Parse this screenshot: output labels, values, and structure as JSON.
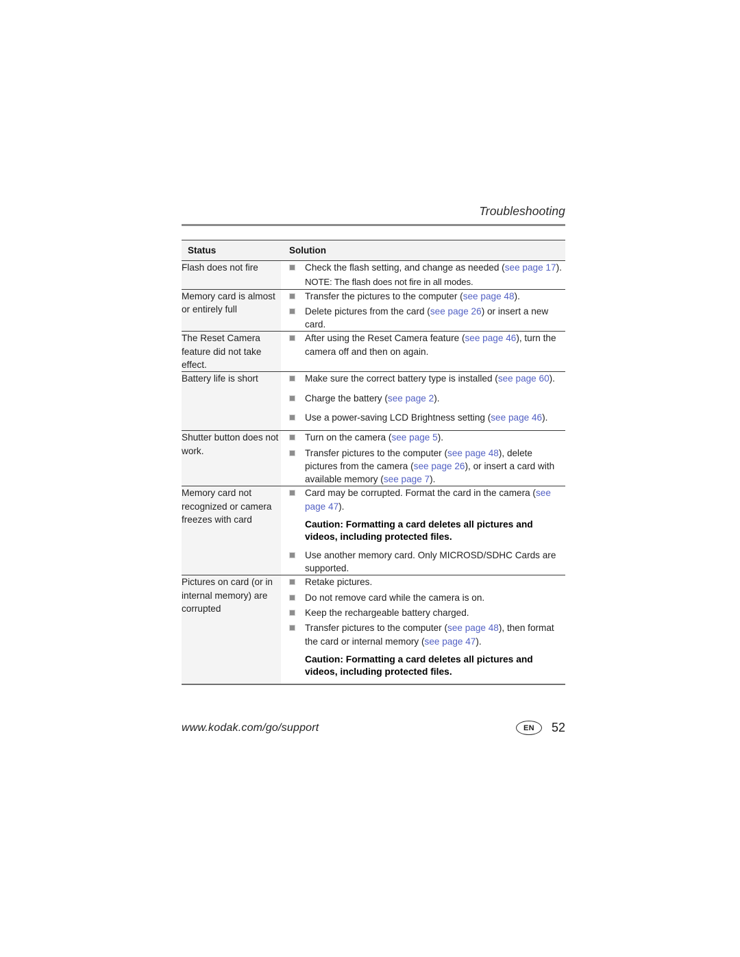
{
  "running_head": {
    "title": "Troubleshooting"
  },
  "table": {
    "headers": {
      "status": "Status",
      "solution": "Solution"
    },
    "rows": [
      {
        "status": "Flash does not fire",
        "items": [
          {
            "bullet": true,
            "parts": [
              {
                "t": "Check the flash setting, and change as needed ("
              },
              {
                "t": "see page 17",
                "link": true
              },
              {
                "t": ")."
              }
            ]
          },
          {
            "bullet": false,
            "note": true,
            "parts": [
              {
                "t": "NOTE:  The flash does not fire in all modes."
              }
            ]
          }
        ]
      },
      {
        "status": "Memory card is almost or entirely full",
        "items": [
          {
            "bullet": true,
            "parts": [
              {
                "t": "Transfer the pictures to the computer ("
              },
              {
                "t": "see page 48",
                "link": true
              },
              {
                "t": ")."
              }
            ]
          },
          {
            "bullet": true,
            "parts": [
              {
                "t": "Delete pictures from the card ("
              },
              {
                "t": "see page 26",
                "link": true
              },
              {
                "t": ") or insert a new card."
              }
            ]
          }
        ]
      },
      {
        "status": "The Reset Camera feature did not take effect.",
        "items": [
          {
            "bullet": true,
            "parts": [
              {
                "t": "After using the Reset Camera feature ("
              },
              {
                "t": "see page 46",
                "link": true
              },
              {
                "t": "), turn the camera off and then on again."
              }
            ]
          }
        ]
      },
      {
        "status": "Battery life is short",
        "items": [
          {
            "bullet": true,
            "parts": [
              {
                "t": "Make sure the correct battery type is installed ("
              },
              {
                "t": "see page 60",
                "link": true
              },
              {
                "t": ")."
              }
            ]
          },
          {
            "bullet": true,
            "parts": [
              {
                "t": "Charge the battery ("
              },
              {
                "t": "see page 2",
                "link": true
              },
              {
                "t": ")."
              }
            ]
          },
          {
            "bullet": true,
            "parts": [
              {
                "t": "Use a power-saving LCD Brightness setting ("
              },
              {
                "t": "see page 46",
                "link": true
              },
              {
                "t": ")."
              }
            ]
          }
        ]
      },
      {
        "status": "Shutter button does not work.",
        "items": [
          {
            "bullet": true,
            "parts": [
              {
                "t": "Turn on the camera ("
              },
              {
                "t": "see page 5",
                "link": true
              },
              {
                "t": ")."
              }
            ]
          },
          {
            "bullet": true,
            "parts": [
              {
                "t": "Transfer pictures to the computer ("
              },
              {
                "t": "see page 48",
                "link": true
              },
              {
                "t": "), delete pictures from the camera ("
              },
              {
                "t": "see page 26",
                "link": true
              },
              {
                "t": "), or insert a card with available memory ("
              },
              {
                "t": "see page 7",
                "link": true
              },
              {
                "t": ")."
              }
            ]
          }
        ]
      },
      {
        "status": "Memory card not recognized or camera freezes with card",
        "items": [
          {
            "bullet": true,
            "parts": [
              {
                "t": "Card may be corrupted. Format the card in the camera ("
              },
              {
                "t": "see page 47",
                "link": true
              },
              {
                "t": ")."
              }
            ]
          },
          {
            "bullet": false,
            "caution": true,
            "parts": [
              {
                "t": "Caution: Formatting a card deletes all pictures and videos, including protected files."
              }
            ]
          },
          {
            "bullet": true,
            "parts": [
              {
                "t": "Use another memory card. Only MICROSD/SDHC Cards are supported."
              }
            ]
          }
        ]
      },
      {
        "status": "Pictures on card (or in internal memory) are corrupted",
        "items": [
          {
            "bullet": true,
            "parts": [
              {
                "t": "Retake pictures."
              }
            ]
          },
          {
            "bullet": true,
            "parts": [
              {
                "t": "Do not remove card while the camera is on."
              }
            ]
          },
          {
            "bullet": true,
            "parts": [
              {
                "t": "Keep the rechargeable battery charged."
              }
            ]
          },
          {
            "bullet": true,
            "parts": [
              {
                "t": "Transfer pictures to the computer ("
              },
              {
                "t": "see page 48",
                "link": true
              },
              {
                "t": "), then format the card or internal memory ("
              },
              {
                "t": "see page 47",
                "link": true
              },
              {
                "t": ")."
              }
            ]
          },
          {
            "bullet": false,
            "caution": true,
            "parts": [
              {
                "t": "Caution: Formatting a card deletes all pictures and videos, including protected files."
              }
            ]
          }
        ]
      }
    ]
  },
  "footer": {
    "url": "www.kodak.com/go/support",
    "language": "EN",
    "page_number": "52"
  },
  "colors": {
    "link": "#5361c4",
    "bullet": "#8d8d8d",
    "rule": "#8b8b8b",
    "status_bg": "#f4f4f4"
  }
}
